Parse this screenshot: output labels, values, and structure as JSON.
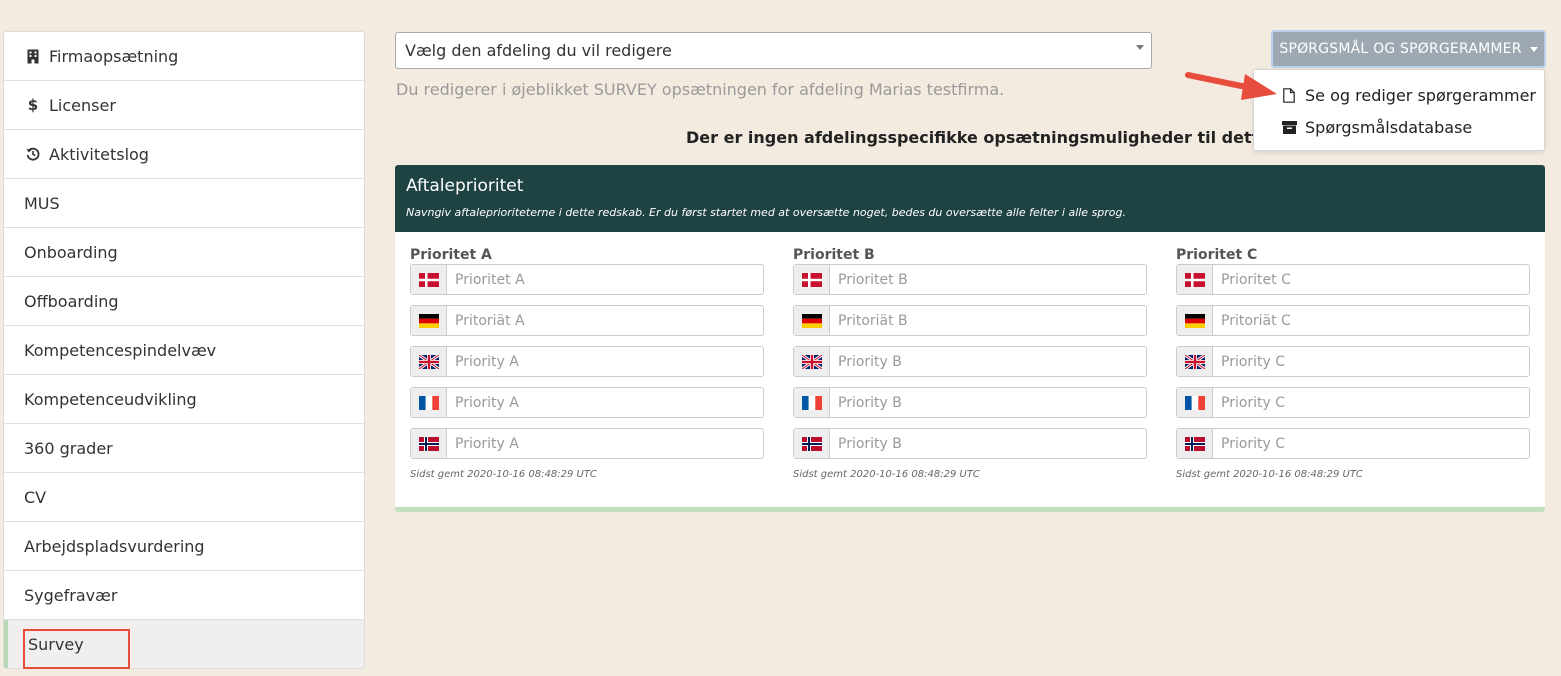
{
  "sidebar": {
    "items": [
      {
        "label": "Firmaopsætning",
        "icon": "building-icon",
        "active": false
      },
      {
        "label": "Licenser",
        "icon": "dollar-icon",
        "active": false
      },
      {
        "label": "Aktivitetslog",
        "icon": "history-icon",
        "active": false
      },
      {
        "label": "MUS",
        "icon": "",
        "active": false
      },
      {
        "label": "Onboarding",
        "icon": "",
        "active": false
      },
      {
        "label": "Offboarding",
        "icon": "",
        "active": false
      },
      {
        "label": "Kompetencespindelvæv",
        "icon": "",
        "active": false
      },
      {
        "label": "Kompetenceudvikling",
        "icon": "",
        "active": false
      },
      {
        "label": "360 grader",
        "icon": "",
        "active": false
      },
      {
        "label": "CV",
        "icon": "",
        "active": false
      },
      {
        "label": "Arbejdspladsvurdering",
        "icon": "",
        "active": false
      },
      {
        "label": "Sygefravær",
        "icon": "",
        "active": false
      },
      {
        "label": "Survey",
        "icon": "",
        "active": true
      }
    ]
  },
  "department_select": {
    "value": "Vælg den afdeling du vil redigere"
  },
  "info_text": "Du redigerer i øjeblikket SURVEY opsætningen for afdeling Marias testfirma.",
  "no_options_text": "Der er ingen afdelingsspecifikke opsætningsmuligheder til dette redskab",
  "dropdown": {
    "button_label": "SPØRGSMÅL OG SPØRGERAMMER",
    "items": [
      {
        "label": "Se og rediger spørgerammer",
        "icon": "file-icon"
      },
      {
        "label": "Spørgsmålsdatabase",
        "icon": "archive-icon"
      }
    ]
  },
  "panel": {
    "title": "Aftaleprioritet",
    "subtitle": "Navngiv aftaleprioriteterne i dette redskab. Er du først startet med at oversætte noget, bedes du oversætte alle felter i alle sprog.",
    "columns": [
      {
        "title": "Prioritet A",
        "fields": [
          {
            "lang": "da",
            "placeholder": "Prioritet A"
          },
          {
            "lang": "de",
            "placeholder": "Pritoriät A"
          },
          {
            "lang": "en",
            "placeholder": "Priority A"
          },
          {
            "lang": "fr",
            "placeholder": "Priority A"
          },
          {
            "lang": "no",
            "placeholder": "Priority A"
          }
        ],
        "saved": "Sidst gemt 2020-10-16 08:48:29 UTC"
      },
      {
        "title": "Prioritet B",
        "fields": [
          {
            "lang": "da",
            "placeholder": "Prioritet B"
          },
          {
            "lang": "de",
            "placeholder": "Pritoriät B"
          },
          {
            "lang": "en",
            "placeholder": "Priority B"
          },
          {
            "lang": "fr",
            "placeholder": "Priority B"
          },
          {
            "lang": "no",
            "placeholder": "Priority B"
          }
        ],
        "saved": "Sidst gemt 2020-10-16 08:48:29 UTC"
      },
      {
        "title": "Prioritet C",
        "fields": [
          {
            "lang": "da",
            "placeholder": "Prioritet C"
          },
          {
            "lang": "de",
            "placeholder": "Pritoriät C"
          },
          {
            "lang": "en",
            "placeholder": "Priority C"
          },
          {
            "lang": "fr",
            "placeholder": "Priority C"
          },
          {
            "lang": "no",
            "placeholder": "Priority C"
          }
        ],
        "saved": "Sidst gemt 2020-10-16 08:48:29 UTC"
      }
    ]
  },
  "colors": {
    "panel_header": "#1f4242",
    "button_bg": "#9ea8b3",
    "annotation_red": "#e74c3c",
    "active_accent": "#b8d7b3"
  }
}
